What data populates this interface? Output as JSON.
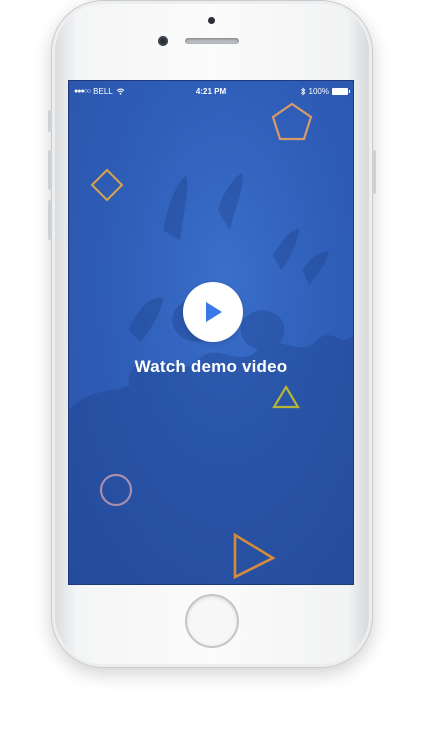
{
  "status_bar": {
    "signal_dots": "●●●○○",
    "carrier": "BELL",
    "wifi_icon": "wifi-icon",
    "time": "4:21 PM",
    "bluetooth_icon": "bluetooth-icon",
    "battery_percent": "100%",
    "battery_level": 1.0
  },
  "main": {
    "play_icon": "play-icon",
    "cta_label": "Watch demo video"
  },
  "colors": {
    "screen_background": "#2f5fb9",
    "play_icon": "#3a78e8",
    "pentagon": "#d89a6a",
    "diamond": "#d9a24e",
    "small_triangle": "#b6b53a",
    "circle": "#a78fb0",
    "large_triangle": "#d48c3c"
  }
}
